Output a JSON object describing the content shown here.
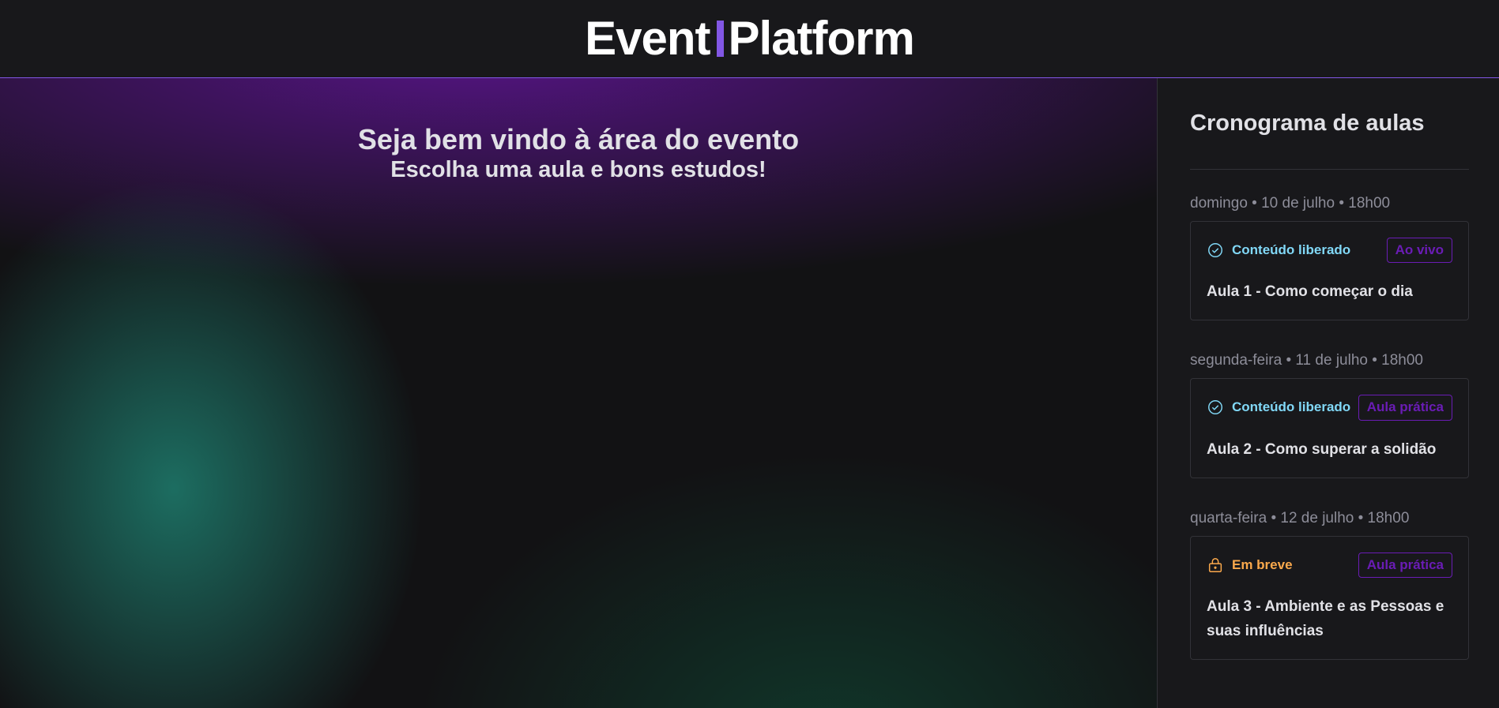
{
  "header": {
    "logo_left": "Event",
    "logo_right": "Platform"
  },
  "main": {
    "welcome_title": "Seja bem vindo à área do evento",
    "welcome_subtitle": "Escolha uma aula e bons estudos!"
  },
  "sidebar": {
    "title": "Cronograma de aulas",
    "lessons": [
      {
        "date": "domingo • 10 de julho • 18h00",
        "status": "Conteúdo liberado",
        "status_icon": "check-circle-icon",
        "badge": "Ao vivo",
        "title": "Aula 1 - Como começar o dia"
      },
      {
        "date": "segunda-feira • 11 de julho • 18h00",
        "status": "Conteúdo liberado",
        "status_icon": "check-circle-icon",
        "badge": "Aula prática",
        "title": "Aula 2 - Como superar a solidão"
      },
      {
        "date": "quarta-feira • 12 de julho • 18h00",
        "status": "Em breve",
        "status_icon": "lock-icon",
        "badge": "Aula prática",
        "title": "Aula 3 - Ambiente e as Pessoas e suas influências"
      }
    ]
  },
  "colors": {
    "accent": "#8257e5",
    "available": "#81d8f7",
    "soon": "#fba94c",
    "badge": "#6a1cb5"
  }
}
